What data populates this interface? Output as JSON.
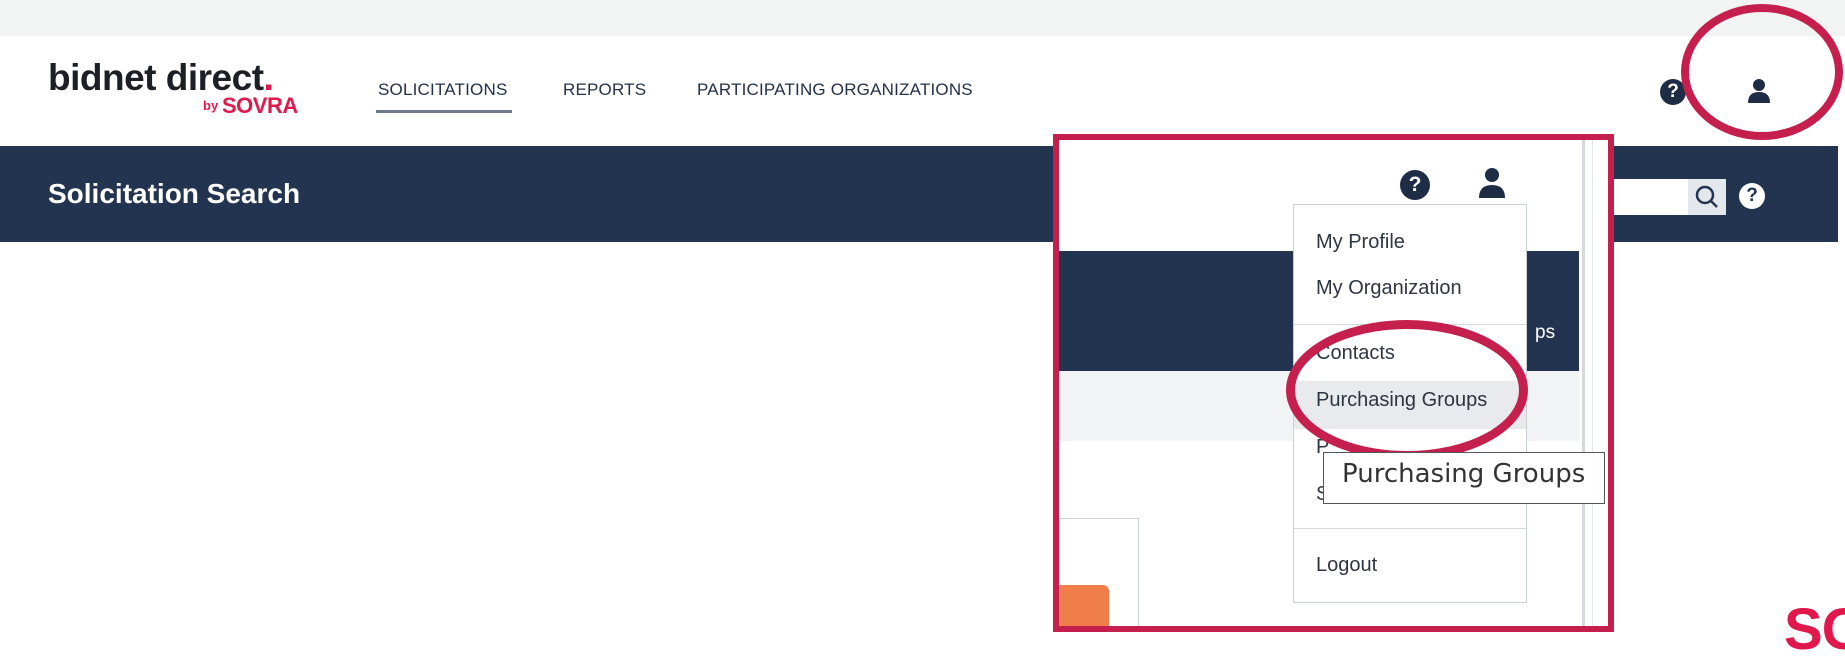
{
  "logo": {
    "name": "bidnet direct",
    "dot": ".",
    "by": "by",
    "brand": "SOVRA"
  },
  "nav": [
    {
      "label": "SOLICITATIONS",
      "active": true
    },
    {
      "label": "REPORTS",
      "active": false
    },
    {
      "label": "PARTICIPATING ORGANIZATIONS",
      "active": false
    }
  ],
  "header": {
    "help_icon": "help-icon",
    "user_icon": "user-icon"
  },
  "banner": {
    "title": "Solicitation Search",
    "search_icon": "search-icon",
    "help_icon": "help-icon"
  },
  "callout": {
    "partial_label": "ps",
    "help_icon": "help-icon",
    "user_icon": "user-icon",
    "menu": {
      "items": [
        "My Profile",
        "My Organization",
        "Contacts",
        "Purchasing Groups"
      ],
      "hidden_initials": [
        "P",
        "S"
      ],
      "logout": "Logout"
    },
    "tooltip": "Purchasing Groups"
  },
  "footer_fragment": "SO",
  "colors": {
    "navy": "#22344f",
    "brand_red": "#e0184c",
    "highlight_ring": "#c51f4e",
    "orange": "#f07e4a"
  }
}
